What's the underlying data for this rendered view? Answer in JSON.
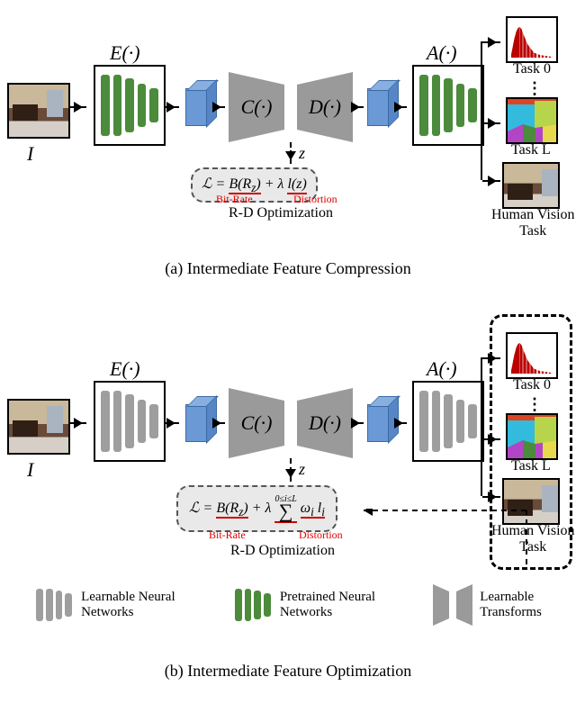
{
  "labels": {
    "I": "I",
    "E": "E(·)",
    "C": "C(·)",
    "D": "D(·)",
    "A": "A(·)",
    "z": "z",
    "rd_opt": "R-D Optimization",
    "task0": "Task 0",
    "taskL": "Task L",
    "human_vision_task": "Human Vision\nTask",
    "bit_rate": "Bit-Rate",
    "distortion": "Distortion"
  },
  "loss": {
    "a_html": "ℒ = <span class='ub'>B(R<sub>z</sub>)</span> + λ <span class='ub'>l(z)</span>",
    "b_html": "ℒ = <span class='ub'>B(R<sub>z</sub>)</span> + λ <span style='display:inline-block;vertical-align:middle;border-bottom:2px solid #c00;padding-bottom:4px;'><span style='font-size:10px;display:block;text-align:center'>0≤i≤L</span><span style='font-size:22px;display:block;text-align:center;line-height:0.7'>∑</span></span> <span class='ub'>ω<sub>i</sub> l<sub>i</sub></span>"
  },
  "captions": {
    "a": "(a) Intermediate Feature Compression",
    "b": "(b) Intermediate Feature Optimization"
  },
  "legend": {
    "learnable_nn": "Learnable Neural\nNetworks",
    "pretrained_nn": "Pretrained Neural\nNetworks",
    "learnable_tf": "Learnable\nTransforms"
  },
  "colors": {
    "green": "#4b8b3b",
    "grey": "#9e9e9e",
    "blue": "#6b99d6",
    "panel_grey": "#9a9a9a",
    "loss_bg": "#e9e9e9",
    "red": "#c00000"
  }
}
